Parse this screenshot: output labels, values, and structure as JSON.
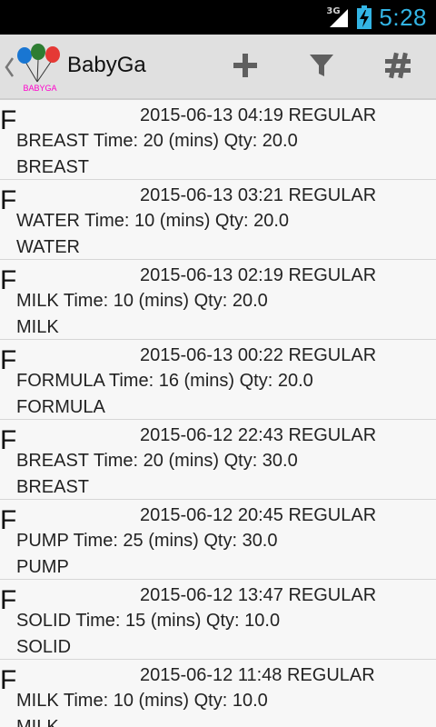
{
  "status_bar": {
    "network_label": "3G",
    "time": "5:28",
    "signal_icon": "signal-icon",
    "battery_icon": "battery-charging-icon"
  },
  "action_bar": {
    "title": "BabyGa",
    "logo_text": "BABYGA",
    "logo_icon": "balloons-logo-icon",
    "actions": [
      {
        "icon": "add-icon"
      },
      {
        "icon": "filter-icon"
      },
      {
        "icon": "hashtag-icon"
      }
    ]
  },
  "colors": {
    "action_bar_bg": "#e0e0e0",
    "status_bar_bg": "#000000",
    "status_time": "#33b5e5",
    "logo_text": "#ff00cc"
  },
  "entries": [
    {
      "type_letter": "F",
      "datetime": "2015-06-13 04:19   REGULAR",
      "detail": "BREAST Time: 20 (mins) Qty: 20.0",
      "category": "BREAST"
    },
    {
      "type_letter": "F",
      "datetime": "2015-06-13 03:21   REGULAR",
      "detail": "WATER Time: 10 (mins) Qty: 20.0",
      "category": "WATER"
    },
    {
      "type_letter": "F",
      "datetime": "2015-06-13 02:19   REGULAR",
      "detail": "MILK Time: 10 (mins) Qty: 20.0",
      "category": "MILK"
    },
    {
      "type_letter": "F",
      "datetime": "2015-06-13 00:22   REGULAR",
      "detail": "FORMULA Time: 16 (mins) Qty: 20.0",
      "category": "FORMULA"
    },
    {
      "type_letter": "F",
      "datetime": "2015-06-12 22:43   REGULAR",
      "detail": "BREAST Time: 20 (mins) Qty: 30.0",
      "category": "BREAST"
    },
    {
      "type_letter": "F",
      "datetime": "2015-06-12 20:45   REGULAR",
      "detail": "PUMP Time: 25 (mins) Qty: 30.0",
      "category": "PUMP"
    },
    {
      "type_letter": "F",
      "datetime": "2015-06-12 13:47   REGULAR",
      "detail": "SOLID Time: 15 (mins) Qty: 10.0",
      "category": "SOLID"
    },
    {
      "type_letter": "F",
      "datetime": "2015-06-12 11:48   REGULAR",
      "detail": "MILK Time: 10 (mins) Qty: 10.0",
      "category": "MILK"
    }
  ]
}
